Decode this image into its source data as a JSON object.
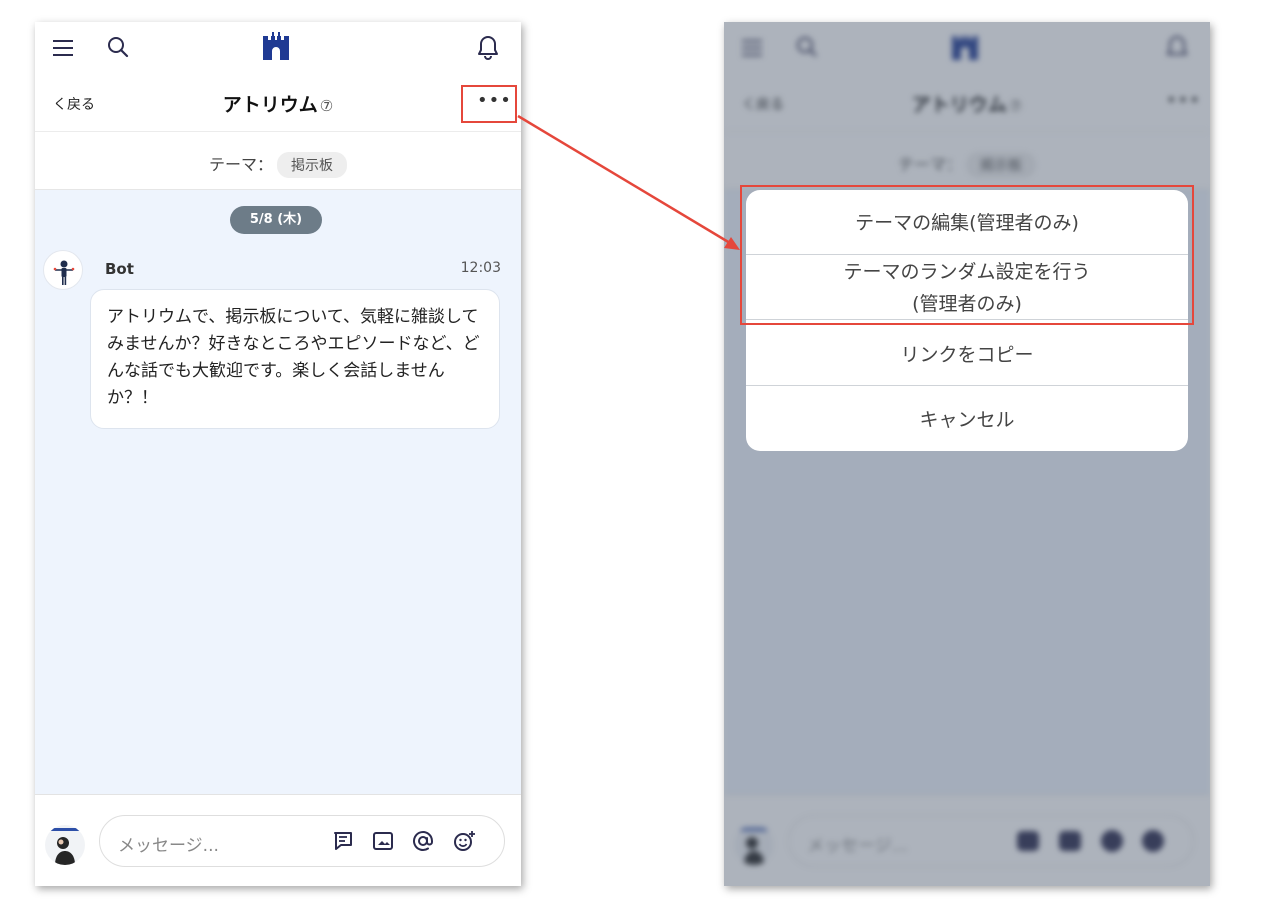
{
  "app": {
    "title": "アトリウム",
    "help_glyph": "⑦",
    "back_label": "く戻る",
    "more_glyph": "•••"
  },
  "theme": {
    "label": "テーマ：",
    "value": "掲示板"
  },
  "chat": {
    "date": "5/8 (木)",
    "message": {
      "sender": "Bot",
      "time": "12:03",
      "text": "アトリウムで、掲示板について、気軽に雑談してみませんか？好きなところやエピソードなど、どんな話でも大歓迎です。楽しく会話しませんか？！"
    }
  },
  "composer": {
    "placeholder": "メッセージ..."
  },
  "action_sheet": {
    "items": [
      {
        "label": "テーマの編集(管理者のみ)"
      },
      {
        "label_line1": "テーマのランダム設定を行う",
        "label_line2": "(管理者のみ)"
      },
      {
        "label": "リンクをコピー"
      },
      {
        "label": "キャンセル"
      }
    ]
  },
  "colors": {
    "accent_navy": "#1f3a93",
    "icon_dark": "#2b2b4e",
    "highlight_red": "#e5473b",
    "chat_bg": "#eef4fd",
    "date_pill": "#6d7c88"
  },
  "icons": [
    "menu-icon",
    "search-icon",
    "castle-logo-icon",
    "bell-icon",
    "thread-icon",
    "image-icon",
    "mention-icon",
    "emoji-add-icon"
  ]
}
